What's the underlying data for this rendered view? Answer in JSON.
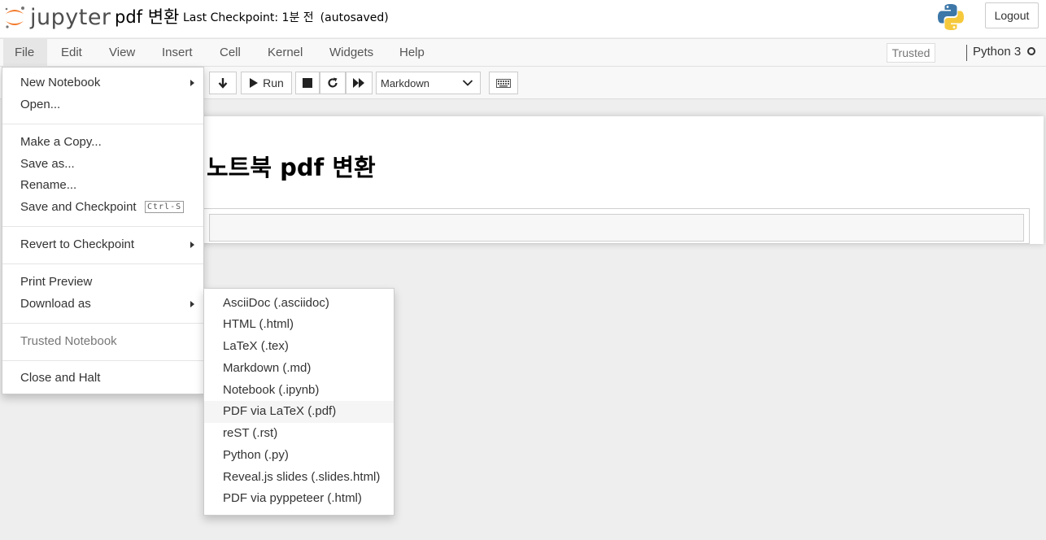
{
  "header": {
    "logo_text": "jupyter",
    "notebook_name": "pdf 변환",
    "checkpoint_text": "Last Checkpoint: 1분 전",
    "autosave_status": "(autosaved)",
    "logout_label": "Logout",
    "logo_icon": "jupyter-logo-icon",
    "python_icon": "python-logo-icon"
  },
  "menubar": {
    "items": [
      "File",
      "Edit",
      "View",
      "Insert",
      "Cell",
      "Kernel",
      "Widgets",
      "Help"
    ],
    "active": "File",
    "trusted_label": "Trusted",
    "kernel_name": "Python 3"
  },
  "toolbar": {
    "run_label": "Run",
    "cell_type": "Markdown",
    "icons": [
      "move-down-icon",
      "run-icon",
      "stop-icon",
      "restart-icon",
      "fast-forward-icon",
      "keyboard-icon",
      "chevron-down-icon"
    ]
  },
  "notebook": {
    "heading": "노트북 pdf 변환"
  },
  "file_menu": {
    "new_notebook": "New Notebook",
    "open": "Open...",
    "make_copy": "Make a Copy...",
    "save_as": "Save as...",
    "rename": "Rename...",
    "save_checkpoint": "Save and Checkpoint",
    "save_shortcut": "Ctrl-S",
    "revert": "Revert to Checkpoint",
    "print_preview": "Print Preview",
    "download_as": "Download as",
    "trusted_notebook": "Trusted Notebook",
    "close_halt": "Close and Halt"
  },
  "download_menu": {
    "items": [
      "AsciiDoc (.asciidoc)",
      "HTML (.html)",
      "LaTeX (.tex)",
      "Markdown (.md)",
      "Notebook (.ipynb)",
      "PDF via LaTeX (.pdf)",
      "reST (.rst)",
      "Python (.py)",
      "Reveal.js slides (.slides.html)",
      "PDF via pyppeteer (.html)"
    ],
    "highlighted": "PDF via LaTeX (.pdf)"
  },
  "colors": {
    "jupyter_orange": "#f37726",
    "menu_bg": "#f8f8f8",
    "page_bg": "#eeeeee"
  }
}
